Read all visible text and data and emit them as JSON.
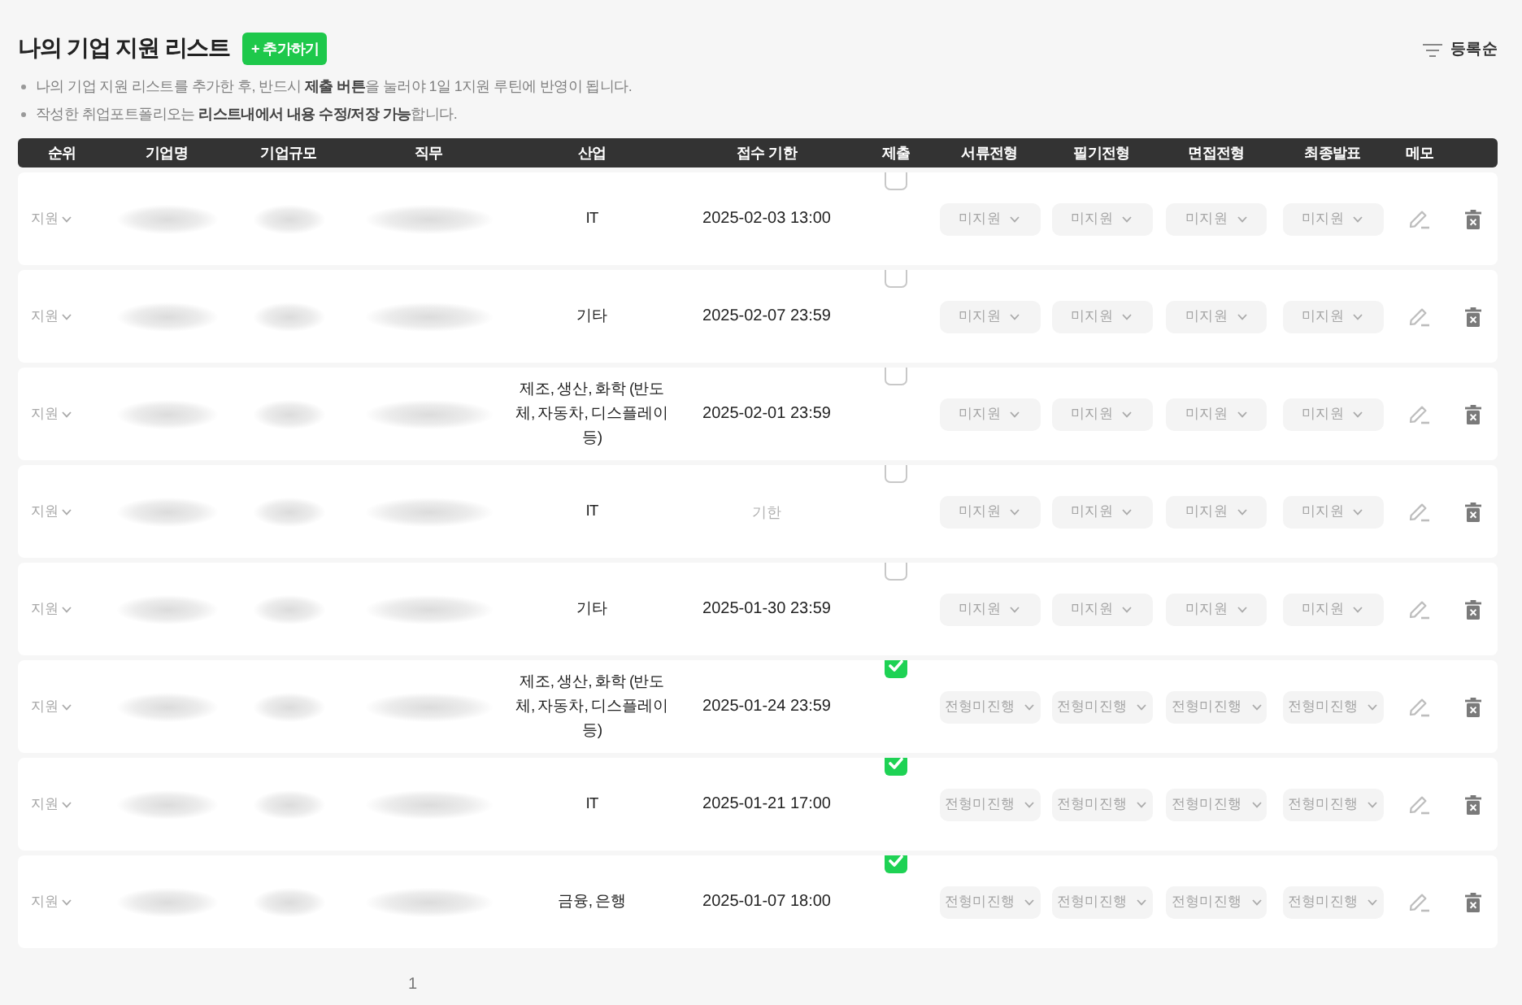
{
  "title": "나의 기업 지원 리스트",
  "add_button": "+ 추가하기",
  "sort": {
    "label": "등록순"
  },
  "notes": [
    "나의 기업 지원 리스트를 추가한 후, 반드시 **제출 버튼**을 눌러야 1일 1지원 루틴에 반영이 됩니다.",
    "작성한 취업포트폴리오는 **리스트내에서 내용 수정/저장 가능**합니다."
  ],
  "table": {
    "columns": [
      "순위",
      "기업명",
      "기업규모",
      "직무",
      "산업",
      "접수 기한",
      "제출",
      "서류전형",
      "필기전형",
      "면접전형",
      "최종발표",
      "메모"
    ],
    "rows": [
      {
        "rank": "지원",
        "industry": "IT",
        "deadline": {
          "value": "2025-02-03 13:00"
        },
        "submitted": false,
        "stages": [
          "미지원",
          "미지원",
          "미지원",
          "미지원"
        ]
      },
      {
        "rank": "지원",
        "industry": "기타",
        "deadline": {
          "value": "2025-02-07 23:59"
        },
        "submitted": false,
        "stages": [
          "미지원",
          "미지원",
          "미지원",
          "미지원"
        ]
      },
      {
        "rank": "지원",
        "industry": "제조, 생산, 화학 (반도체, 자동차, 디스플레이 등)",
        "deadline": {
          "value": "2025-02-01 23:59"
        },
        "submitted": false,
        "stages": [
          "미지원",
          "미지원",
          "미지원",
          "미지원"
        ]
      },
      {
        "rank": "지원",
        "industry": "IT",
        "deadline": {
          "placeholder": "기한"
        },
        "submitted": false,
        "stages": [
          "미지원",
          "미지원",
          "미지원",
          "미지원"
        ]
      },
      {
        "rank": "지원",
        "industry": "기타",
        "deadline": {
          "value": "2025-01-30 23:59"
        },
        "submitted": false,
        "stages": [
          "미지원",
          "미지원",
          "미지원",
          "미지원"
        ]
      },
      {
        "rank": "지원",
        "industry": "제조, 생산, 화학 (반도체, 자동차, 디스플레이 등)",
        "deadline": {
          "value": "2025-01-24 23:59"
        },
        "submitted": true,
        "stages": [
          "전형미진행",
          "전형미진행",
          "전형미진행",
          "전형미진행"
        ]
      },
      {
        "rank": "지원",
        "industry": "IT",
        "deadline": {
          "value": "2025-01-21 17:00"
        },
        "submitted": true,
        "stages": [
          "전형미진행",
          "전형미진행",
          "전형미진행",
          "전형미진행"
        ]
      },
      {
        "rank": "지원",
        "industry": "금융, 은행",
        "deadline": {
          "value": "2025-01-07 18:00"
        },
        "submitted": true,
        "stages": [
          "전형미진행",
          "전형미진행",
          "전형미진행",
          "전형미진행"
        ]
      }
    ]
  },
  "pagination": {
    "pages": [
      "1"
    ]
  }
}
